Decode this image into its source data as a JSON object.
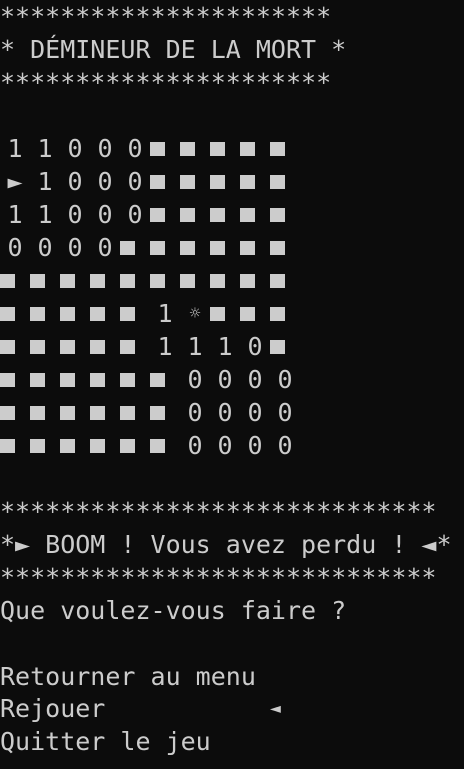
{
  "title_frame": {
    "top_stars": "**********************",
    "title": "* DÉMINEUR DE LA MORT *",
    "bottom_stars": "**********************"
  },
  "board": {
    "hidden_glyph": "■",
    "mine_glyph": "☼",
    "row_cursor_glyph": "►",
    "rows": [
      [
        "1",
        "1",
        "0",
        "0",
        "0",
        "■",
        "■",
        "■",
        "■",
        "■"
      ],
      [
        "►",
        "1",
        "0",
        "0",
        "0",
        "■",
        "■",
        "■",
        "■",
        "■"
      ],
      [
        "1",
        "1",
        "0",
        "0",
        "0",
        "■",
        "■",
        "■",
        "■",
        "■"
      ],
      [
        "0",
        "0",
        "0",
        "0",
        "■",
        "■",
        "■",
        "■",
        "■",
        "■"
      ],
      [
        "■",
        "■",
        "■",
        "■",
        "■",
        "■",
        "■",
        "■",
        "■",
        "■"
      ],
      [
        "■",
        "■",
        "■",
        "■",
        "■",
        "1",
        "☼",
        "■",
        "■",
        "■"
      ],
      [
        "■",
        "■",
        "■",
        "■",
        "■",
        "1",
        "1",
        "1",
        "0",
        "■"
      ],
      [
        "■",
        "■",
        "■",
        "■",
        "■",
        "■",
        "0",
        "0",
        "0",
        "0"
      ],
      [
        "■",
        "■",
        "■",
        "■",
        "■",
        "■",
        "0",
        "0",
        "0",
        "0"
      ],
      [
        "■",
        "■",
        "■",
        "■",
        "■",
        "■",
        "0",
        "0",
        "0",
        "0"
      ]
    ]
  },
  "result_frame": {
    "top_stars": "*****************************",
    "message": "*► BOOM ! Vous avez perdu ! ◄*",
    "bottom_stars": "*****************************"
  },
  "prompt": "Que voulez-vous faire ?",
  "menu": {
    "items": [
      {
        "label": "Retourner au menu"
      },
      {
        "label": "Rejouer"
      },
      {
        "label": "Quitter le jeu"
      }
    ],
    "selected_index": 1,
    "selection_marker": "◄"
  }
}
